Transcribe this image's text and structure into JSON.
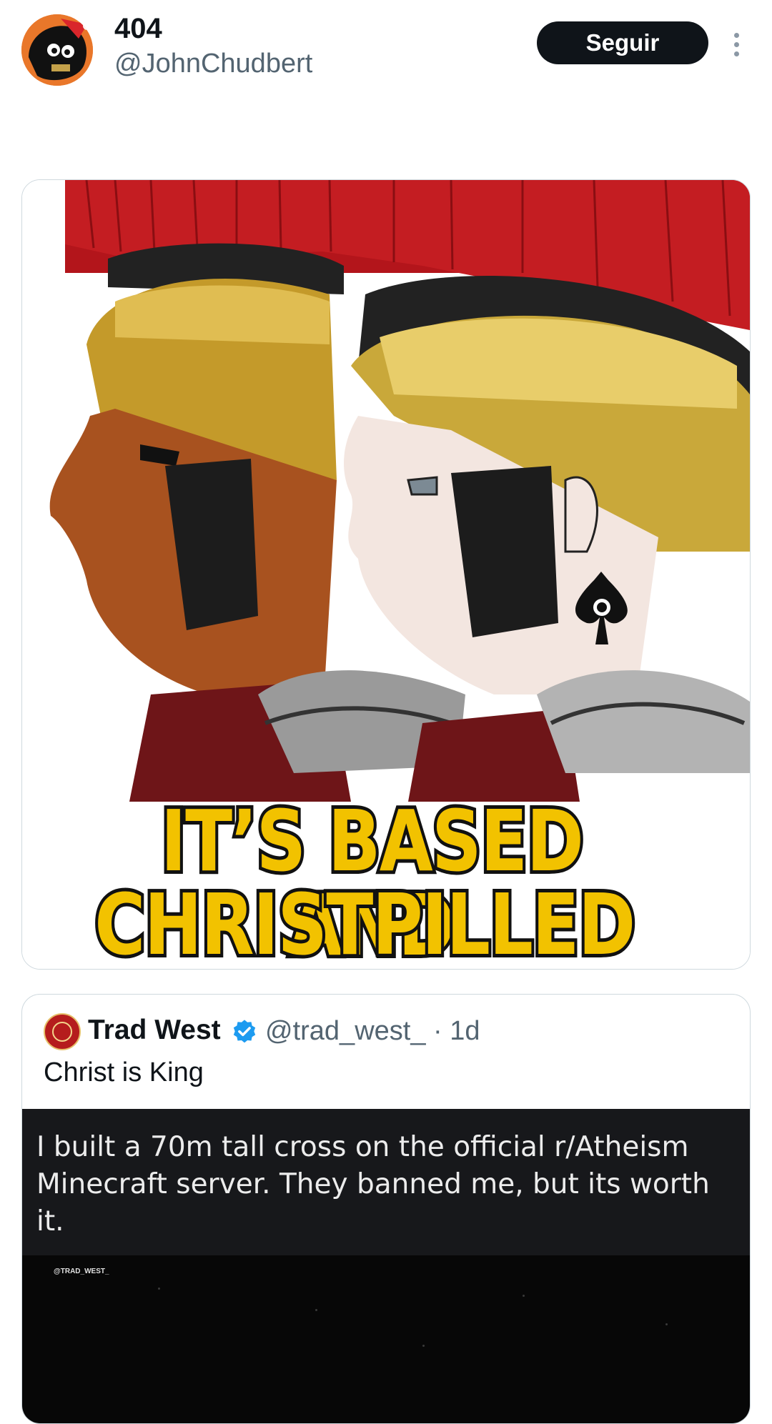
{
  "header": {
    "display_name": "404",
    "handle": "@JohnChudbert",
    "follow_label": "Seguir",
    "more_icon": "more-vertical-icon",
    "avatar_icon": "profile-avatar"
  },
  "meme": {
    "caption_line1": "IT’S BASED AND",
    "caption_line2": "CHRISTPILLED",
    "caption_color": "#f2c200"
  },
  "quote": {
    "author_name": "Trad West",
    "verified_icon": "verified-badge-icon",
    "author_handle_time": "@trad_west_ · 1d",
    "text": "Christ is King",
    "media": {
      "banner_text": "I built a 70m tall cross on the official r/Atheism Minecraft server. They banned me, but its worth it.",
      "watermark": "@TRAD_WEST_"
    }
  },
  "colors": {
    "text_primary": "#0f1419",
    "text_secondary": "#536471",
    "verified_blue": "#1d9bf0",
    "border": "#cfd9de"
  }
}
